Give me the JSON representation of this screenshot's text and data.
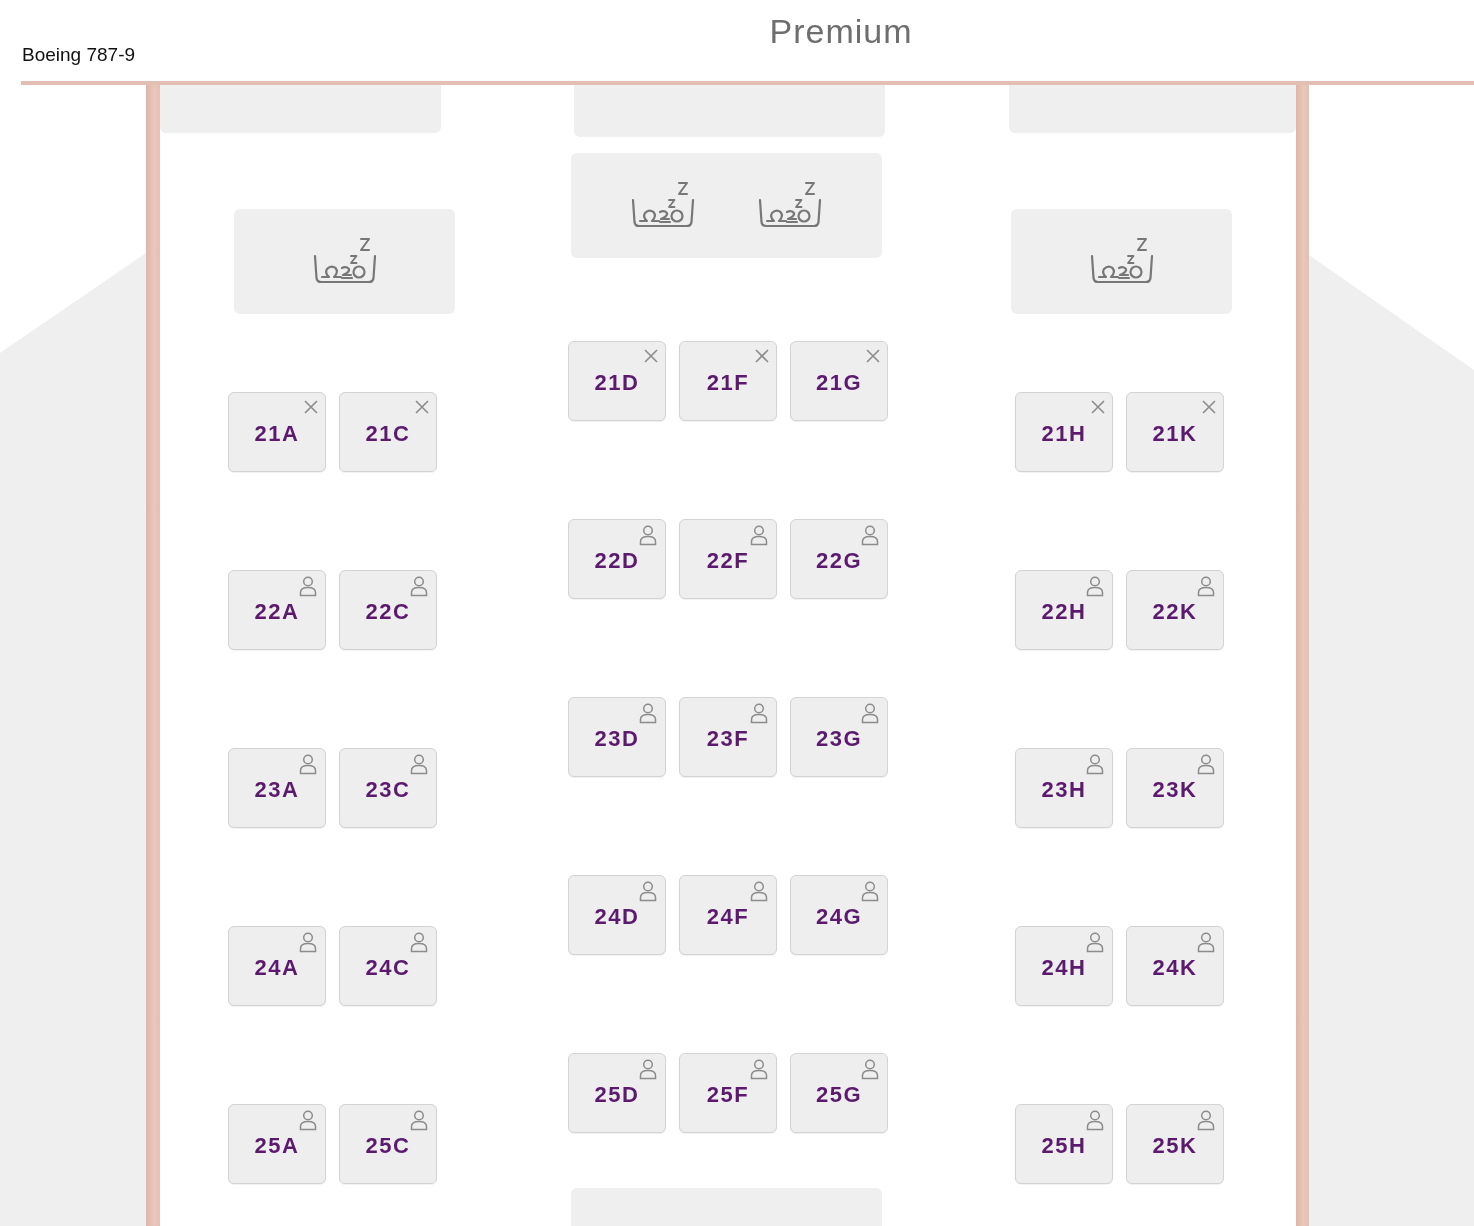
{
  "header": {
    "aircraft": "Boeing 787-9",
    "cabin_title": "Premium"
  },
  "cabin": {
    "sections": [
      {
        "rows": [
          {
            "seats": [
              {
                "label": "21A",
                "blocked": true
              },
              {
                "label": "21C",
                "blocked": true
              }
            ]
          },
          {
            "seats": [
              {
                "label": "22A",
                "blocked": false
              },
              {
                "label": "22C",
                "blocked": false
              }
            ]
          },
          {
            "seats": [
              {
                "label": "23A",
                "blocked": false
              },
              {
                "label": "23C",
                "blocked": false
              }
            ]
          },
          {
            "seats": [
              {
                "label": "24A",
                "blocked": false
              },
              {
                "label": "24C",
                "blocked": false
              }
            ]
          },
          {
            "seats": [
              {
                "label": "25A",
                "blocked": false
              },
              {
                "label": "25C",
                "blocked": false
              }
            ]
          }
        ]
      },
      {
        "rows": [
          {
            "seats": [
              {
                "label": "21D",
                "blocked": true
              },
              {
                "label": "21F",
                "blocked": true
              },
              {
                "label": "21G",
                "blocked": true
              }
            ]
          },
          {
            "seats": [
              {
                "label": "22D",
                "blocked": false
              },
              {
                "label": "22F",
                "blocked": false
              },
              {
                "label": "22G",
                "blocked": false
              }
            ]
          },
          {
            "seats": [
              {
                "label": "23D",
                "blocked": false
              },
              {
                "label": "23F",
                "blocked": false
              },
              {
                "label": "23G",
                "blocked": false
              }
            ]
          },
          {
            "seats": [
              {
                "label": "24D",
                "blocked": false
              },
              {
                "label": "24F",
                "blocked": false
              },
              {
                "label": "24G",
                "blocked": false
              }
            ]
          },
          {
            "seats": [
              {
                "label": "25D",
                "blocked": false
              },
              {
                "label": "25F",
                "blocked": false
              },
              {
                "label": "25G",
                "blocked": false
              }
            ]
          }
        ]
      },
      {
        "rows": [
          {
            "seats": [
              {
                "label": "21H",
                "blocked": true
              },
              {
                "label": "21K",
                "blocked": true
              }
            ]
          },
          {
            "seats": [
              {
                "label": "22H",
                "blocked": false
              },
              {
                "label": "22K",
                "blocked": false
              }
            ]
          },
          {
            "seats": [
              {
                "label": "23H",
                "blocked": false
              },
              {
                "label": "23K",
                "blocked": false
              }
            ]
          },
          {
            "seats": [
              {
                "label": "24H",
                "blocked": false
              },
              {
                "label": "24K",
                "blocked": false
              }
            ]
          },
          {
            "seats": [
              {
                "label": "25H",
                "blocked": false
              },
              {
                "label": "25K",
                "blocked": false
              }
            ]
          }
        ]
      }
    ]
  }
}
